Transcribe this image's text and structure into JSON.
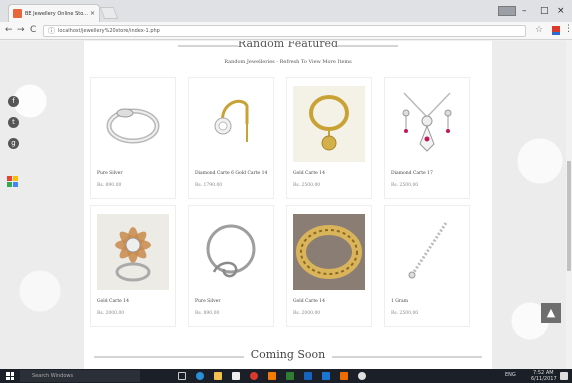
{
  "browser": {
    "tab_title": "BE Jewellery Online Sto...",
    "tab_close": "×",
    "url": "localhost/jewellery%20store/index-1.php",
    "back": "←",
    "forward": "→",
    "reload": "C",
    "info": "ⓘ",
    "star": "☆",
    "menu": "⋮",
    "win_min": "–",
    "win_max": "□",
    "win_close": "×"
  },
  "page": {
    "section_title": "Random Featured",
    "subtitle": "Random Jewelleries - Refresh To View More Items",
    "coming_soon": "Coming Soon",
    "scroll_top": "▲"
  },
  "social": [
    {
      "icon": "facebook-icon",
      "glyph": "f"
    },
    {
      "icon": "twitter-icon",
      "glyph": "t"
    },
    {
      "icon": "google-icon",
      "glyph": "g"
    }
  ],
  "products": [
    {
      "name": "Pure Silver",
      "price": "Rs. 890.00",
      "icon": "silver-ring-image"
    },
    {
      "name": "Diamond Carte 6 Gold Carte 14",
      "price": "Rs. 1790.00",
      "icon": "diamond-nose-pin-image"
    },
    {
      "name": "Gold Carte 14",
      "price": "Rs. 2500.00",
      "icon": "gold-pendant-image"
    },
    {
      "name": "Diamond Carte 17",
      "price": "Rs. 2500.00",
      "icon": "diamond-necklace-image"
    },
    {
      "name": "Gold Carte 14",
      "price": "Rs. 2000.00",
      "icon": "flower-ring-image"
    },
    {
      "name": "Pure Silver",
      "price": "Rs. 890.00",
      "icon": "silver-swirl-ring-image"
    },
    {
      "name": "Gold Carte 14",
      "price": "Rs. 2000.00",
      "icon": "gold-bangle-image"
    },
    {
      "name": "1 Gram",
      "price": "Rs. 2500.00",
      "icon": "bracelet-image"
    }
  ],
  "taskbar": {
    "search_placeholder": "Search Windows",
    "time": "7:52 AM",
    "date": "6/11/2017",
    "lang": "ENG"
  },
  "colors": {
    "taskbar": "#1b1f27",
    "panel": "#ffffff",
    "gold": "#c9a236",
    "tab_accent": "#e6663a"
  }
}
